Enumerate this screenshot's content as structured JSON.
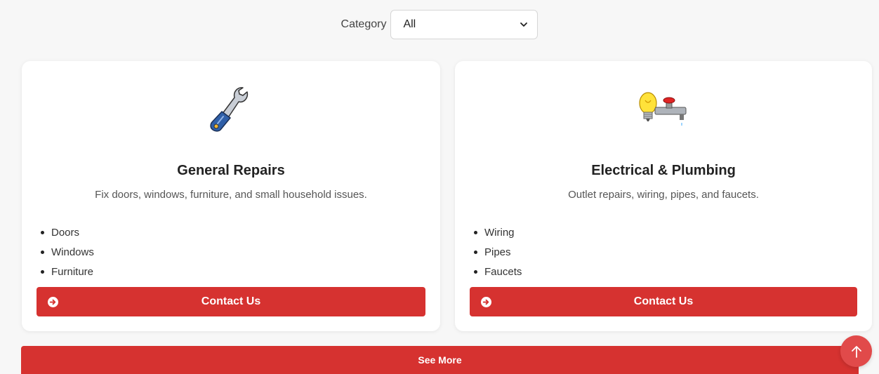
{
  "filter": {
    "label": "Category",
    "selected": "All"
  },
  "cards": [
    {
      "icon": "wrench-icon",
      "title": "General Repairs",
      "description": "Fix doors, windows, furniture, and small household issues.",
      "items": [
        "Doors",
        "Windows",
        "Furniture"
      ],
      "button_label": "Contact Us"
    },
    {
      "icon": "lightbulb-faucet-icon",
      "title": "Electrical & Plumbing",
      "description": "Outlet repairs, wiring, pipes, and faucets.",
      "items": [
        "Wiring",
        "Pipes",
        "Faucets"
      ],
      "button_label": "Contact Us"
    }
  ],
  "see_more_label": "See More",
  "colors": {
    "accent": "#d63230",
    "background": "#f7f7f7",
    "scroll_top": "#e14a4a"
  }
}
